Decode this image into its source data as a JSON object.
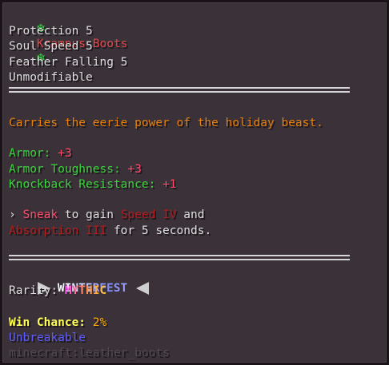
{
  "item": {
    "name": "Krampus Boots",
    "enchantments": [
      "Protection 5",
      "Soul Speed 5",
      "Feather Falling 5"
    ],
    "modifiable": "Unmodifiable",
    "lore": "Carries the eerie power of the holiday beast.",
    "stats": [
      {
        "label": "Armor:",
        "value": "+3"
      },
      {
        "label": "Armor Toughness:",
        "value": "+3"
      },
      {
        "label": "Knockback Resistance:",
        "value": "+1"
      }
    ],
    "ability": {
      "prefix": "›",
      "sneak": "Sneak",
      "to_gain": "to gain",
      "speed": "Speed IV",
      "and": "and",
      "absorption": "Absorption III",
      "duration": "for 5 seconds."
    },
    "event": "WINTERFEST",
    "rarity_label": "Rarity:",
    "rarity_value": "MYTHIC",
    "win_chance_label": "Win Chance:",
    "win_chance_value": "2%",
    "unbreakable": "Unbreakable",
    "item_id": "minecraft:leather_boots"
  },
  "colors": {
    "background": "#3a3139",
    "name": "#e04848",
    "lore": "#e8800a",
    "stat_label": "#3ad23a",
    "stat_value": "#ff4a6a",
    "ability_keyword": "#b01c1c",
    "unbreakable": "#5b5bff",
    "item_id": "#4e4a4e"
  }
}
